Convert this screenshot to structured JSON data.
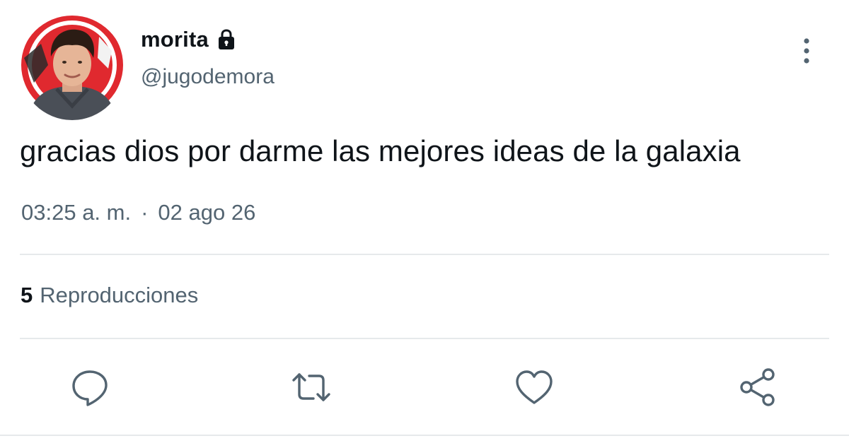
{
  "author": {
    "display_name": "morita",
    "handle": "@jugodemora",
    "protected_icon": "lock-icon"
  },
  "tweet": {
    "text": "gracias dios por darme las mejores ideas de la galaxia",
    "time": "03:25 a. m.",
    "separator": "·",
    "date": "02 ago 26"
  },
  "stats": {
    "views_count": "5",
    "views_label": "Reproducciones"
  },
  "actions": [
    {
      "name": "reply",
      "icon": "speech-bubble-icon"
    },
    {
      "name": "retweet",
      "icon": "retweet-arrows-icon"
    },
    {
      "name": "like",
      "icon": "heart-icon"
    },
    {
      "name": "share",
      "icon": "share-nodes-icon"
    }
  ],
  "menu": {
    "icon": "vertical-dots-icon"
  },
  "colors": {
    "text_primary": "#0f1419",
    "text_secondary": "#536471",
    "divider": "#e6e9eb",
    "avatar_ring": "#e0292f"
  }
}
